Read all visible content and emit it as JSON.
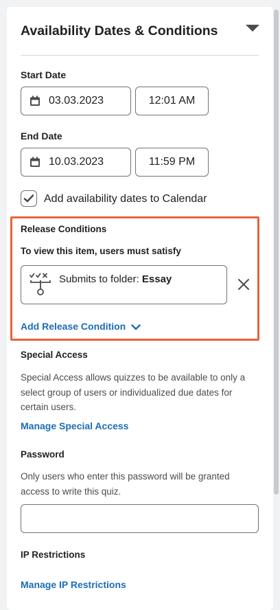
{
  "section": {
    "title": "Availability Dates & Conditions"
  },
  "start_date": {
    "label": "Start Date",
    "date": "03.03.2023",
    "time": "12:01 AM"
  },
  "end_date": {
    "label": "End Date",
    "date": "10.03.2023",
    "time": "11:59 PM"
  },
  "calendar_option": {
    "label": "Add availability dates to Calendar",
    "checked": true
  },
  "release_conditions": {
    "heading": "Release Conditions",
    "subheading": "To view this item, users must satisfy",
    "condition_prefix": "Submits to folder:",
    "condition_value": "Essay",
    "add_link": "Add Release Condition"
  },
  "special_access": {
    "heading": "Special Access",
    "description": "Special Access allows quizzes to be available to only a select group of users or individualized due dates for certain users.",
    "link": "Manage Special Access"
  },
  "password": {
    "heading": "Password",
    "description": "Only users who enter this password will be granted access to write this quiz.",
    "value": ""
  },
  "ip_restrictions": {
    "heading": "IP Restrictions",
    "link": "Manage IP Restrictions"
  },
  "colors": {
    "link": "#1b6cb5",
    "highlight": "#e8623a",
    "text": "#202122"
  },
  "icons": [
    "calendar-icon",
    "checkmark-icon",
    "release-condition-icon",
    "close-icon",
    "chevron-down-icon",
    "collapse-caret-icon"
  ]
}
